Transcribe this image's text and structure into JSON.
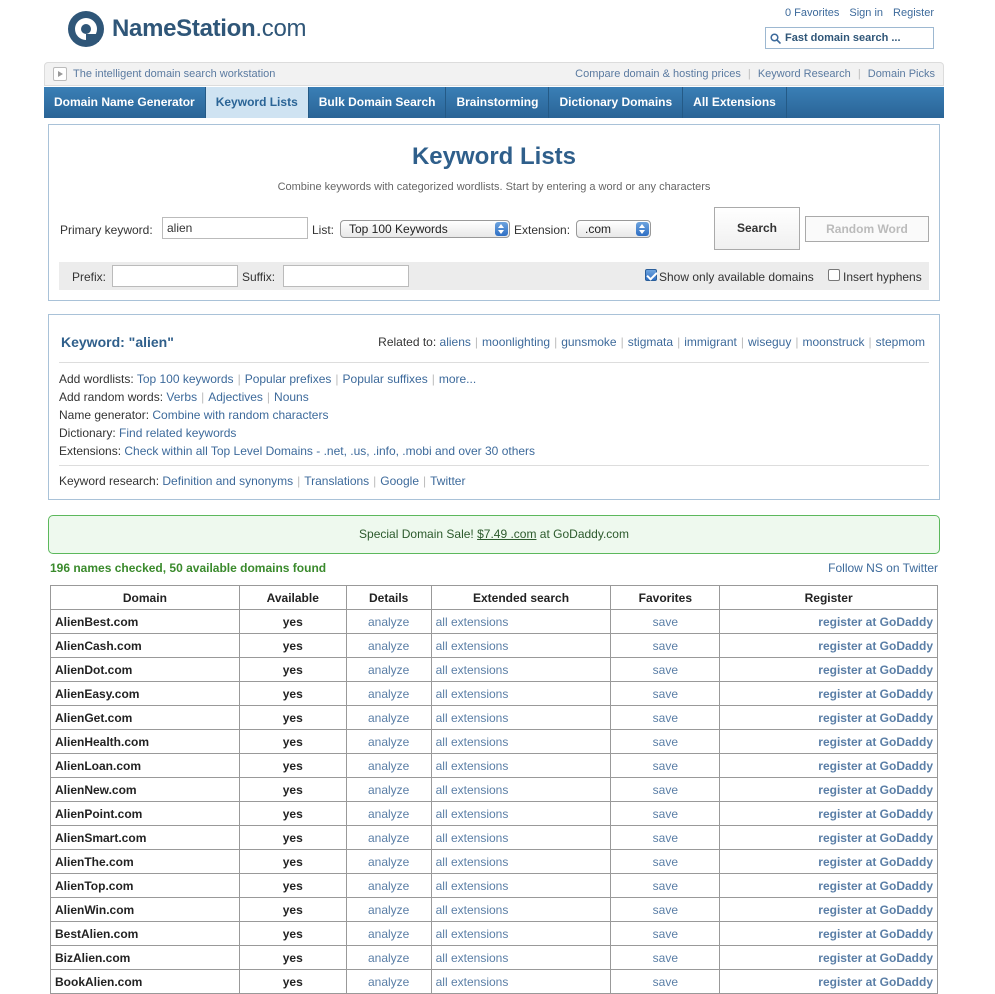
{
  "brand": {
    "name_bold": "NameStation",
    "name_suffix": ".com"
  },
  "top_links": [
    "0 Favorites",
    "Sign in",
    "Register"
  ],
  "fast_search": {
    "placeholder": "Fast domain search ..."
  },
  "tagbar": {
    "tagline": "The intelligent domain search workstation",
    "links": [
      "Compare domain & hosting prices",
      "Keyword Research",
      "Domain Picks"
    ]
  },
  "nav": {
    "tabs": [
      {
        "label": "Domain Name Generator",
        "active": false
      },
      {
        "label": "Keyword Lists",
        "active": true
      },
      {
        "label": "Bulk Domain Search",
        "active": false
      },
      {
        "label": "Brainstorming",
        "active": false
      },
      {
        "label": "Dictionary Domains",
        "active": false
      },
      {
        "label": "All Extensions",
        "active": false
      }
    ]
  },
  "search": {
    "title": "Keyword Lists",
    "subtitle": "Combine keywords with categorized wordlists. Start by entering a word or any characters",
    "primary_label": "Primary keyword:",
    "primary_value": "alien",
    "list_label": "List:",
    "list_value": "Top 100 Keywords",
    "ext_label": "Extension:",
    "ext_value": ".com",
    "search_button": "Search",
    "random_button": "Random Word",
    "prefix_label": "Prefix:",
    "suffix_label": "Suffix:",
    "prefix_value": "",
    "suffix_value": "",
    "available_only_label": "Show only available domains",
    "available_only_checked": true,
    "hyphens_label": "Insert hyphens",
    "hyphens_checked": false
  },
  "keyword": {
    "title": "Keyword: \"alien\"",
    "related_label": "Related to:",
    "related": [
      "aliens",
      "moonlighting",
      "gunsmoke",
      "stigmata",
      "immigrant",
      "wiseguy",
      "moonstruck",
      "stepmom"
    ],
    "wordlists_label": "Add wordlists:",
    "wordlists": [
      "Top 100 keywords",
      "Popular prefixes",
      "Popular suffixes",
      "more..."
    ],
    "random_label": "Add random words:",
    "random": [
      "Verbs",
      "Adjectives",
      "Nouns"
    ],
    "generator_label": "Name generator:",
    "generator_link": "Combine with random characters",
    "dictionary_label": "Dictionary:",
    "dictionary_link": "Find related keywords",
    "extensions_label": "Extensions:",
    "extensions_link": "Check within all Top Level Domains - .net, .us, .info, .mobi and over 30 others",
    "research_label": "Keyword research:",
    "research": [
      "Definition and synonyms",
      "Translations",
      "Google",
      "Twitter"
    ]
  },
  "sale": {
    "prefix": "Special Domain Sale! ",
    "price": "$7.49 .com",
    "suffix": " at GoDaddy.com"
  },
  "summary": "196 names checked, 50 available domains found",
  "follow": "Follow NS on Twitter",
  "table": {
    "headers": [
      "Domain",
      "Available",
      "Details",
      "Extended search",
      "Favorites",
      "Register"
    ],
    "rows": [
      {
        "domain": "AlienBest.com",
        "available": "yes",
        "details": "analyze",
        "ext": "all extensions",
        "fav": "save",
        "register": "register at GoDaddy"
      },
      {
        "domain": "AlienCash.com",
        "available": "yes",
        "details": "analyze",
        "ext": "all extensions",
        "fav": "save",
        "register": "register at GoDaddy"
      },
      {
        "domain": "AlienDot.com",
        "available": "yes",
        "details": "analyze",
        "ext": "all extensions",
        "fav": "save",
        "register": "register at GoDaddy"
      },
      {
        "domain": "AlienEasy.com",
        "available": "yes",
        "details": "analyze",
        "ext": "all extensions",
        "fav": "save",
        "register": "register at GoDaddy"
      },
      {
        "domain": "AlienGet.com",
        "available": "yes",
        "details": "analyze",
        "ext": "all extensions",
        "fav": "save",
        "register": "register at GoDaddy"
      },
      {
        "domain": "AlienHealth.com",
        "available": "yes",
        "details": "analyze",
        "ext": "all extensions",
        "fav": "save",
        "register": "register at GoDaddy"
      },
      {
        "domain": "AlienLoan.com",
        "available": "yes",
        "details": "analyze",
        "ext": "all extensions",
        "fav": "save",
        "register": "register at GoDaddy"
      },
      {
        "domain": "AlienNew.com",
        "available": "yes",
        "details": "analyze",
        "ext": "all extensions",
        "fav": "save",
        "register": "register at GoDaddy"
      },
      {
        "domain": "AlienPoint.com",
        "available": "yes",
        "details": "analyze",
        "ext": "all extensions",
        "fav": "save",
        "register": "register at GoDaddy"
      },
      {
        "domain": "AlienSmart.com",
        "available": "yes",
        "details": "analyze",
        "ext": "all extensions",
        "fav": "save",
        "register": "register at GoDaddy"
      },
      {
        "domain": "AlienThe.com",
        "available": "yes",
        "details": "analyze",
        "ext": "all extensions",
        "fav": "save",
        "register": "register at GoDaddy"
      },
      {
        "domain": "AlienTop.com",
        "available": "yes",
        "details": "analyze",
        "ext": "all extensions",
        "fav": "save",
        "register": "register at GoDaddy"
      },
      {
        "domain": "AlienWin.com",
        "available": "yes",
        "details": "analyze",
        "ext": "all extensions",
        "fav": "save",
        "register": "register at GoDaddy"
      },
      {
        "domain": "BestAlien.com",
        "available": "yes",
        "details": "analyze",
        "ext": "all extensions",
        "fav": "save",
        "register": "register at GoDaddy"
      },
      {
        "domain": "BizAlien.com",
        "available": "yes",
        "details": "analyze",
        "ext": "all extensions",
        "fav": "save",
        "register": "register at GoDaddy"
      },
      {
        "domain": "BookAlien.com",
        "available": "yes",
        "details": "analyze",
        "ext": "all extensions",
        "fav": "save",
        "register": "register at GoDaddy"
      }
    ]
  },
  "colors": {
    "brand": "#2f5678",
    "nav": "#2a6496",
    "link": "#3d6a9b",
    "available": "#3a8a2c"
  }
}
